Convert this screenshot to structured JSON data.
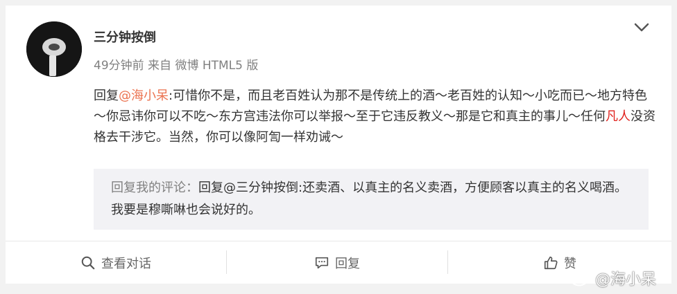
{
  "post": {
    "username": "三分钟按倒",
    "meta": "49分钟前 来自 微博 HTML5 版",
    "content": {
      "prefix": "回复",
      "mention": "@海小呆",
      "text1": ":可惜你不是，而且老百姓认为那不是传统上的酒～老百姓的认知～小吃而已～地方特色～你忌讳你可以不吃～东方宫违法你可以举报～至于它违反教义～那是它和真主的事儿～任何",
      "highlight": "凡人",
      "text2": "没资格去干涉它。当然，你可以像阿訇一样劝诫～"
    },
    "quote": {
      "label": "回复我的评论：",
      "text": "回复@三分钟按倒:还卖酒、以真主的名义卖酒，方便顾客以真主的名义喝酒。我要是穆嘶啉也会说好的。"
    }
  },
  "actions": {
    "view_conversation": "查看对话",
    "reply": "回复",
    "like": "赞"
  },
  "watermark": "@海小呆",
  "colors": {
    "mention": "#eb7350",
    "highlight": "#e0201c",
    "quote_bg": "#f2f2f5"
  },
  "icons": [
    "chevron-down-icon",
    "search-icon",
    "comment-icon",
    "thumbs-up-icon",
    "weibo-logo-icon"
  ]
}
